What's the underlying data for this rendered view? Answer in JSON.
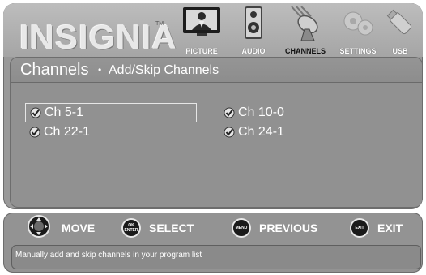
{
  "brand": {
    "logo": "INSIGNIA",
    "tm": "TM"
  },
  "tabs": [
    {
      "label": "PICTURE",
      "icon": "tv-picture-icon",
      "active": false
    },
    {
      "label": "AUDIO",
      "icon": "speaker-icon",
      "active": false
    },
    {
      "label": "CHANNELS",
      "icon": "satellite-dish-icon",
      "active": true
    },
    {
      "label": "SETTINGS",
      "icon": "gears-icon",
      "active": false
    },
    {
      "label": "USB",
      "icon": "usb-stick-icon",
      "active": false
    }
  ],
  "page": {
    "title": "Channels",
    "separator": "•",
    "subtitle": "Add/Skip Channels"
  },
  "channels": [
    {
      "label": "Ch 5-1",
      "checked": true,
      "selected": true
    },
    {
      "label": "Ch 10-0",
      "checked": true,
      "selected": false
    },
    {
      "label": "Ch 22-1",
      "checked": true,
      "selected": false
    },
    {
      "label": "Ch 24-1",
      "checked": true,
      "selected": false
    }
  ],
  "hints": [
    {
      "label": "MOVE",
      "icon": "dpad-icon"
    },
    {
      "label": "SELECT",
      "icon": "ok-enter-button-icon",
      "button_text": [
        "OK",
        "ENTER"
      ]
    },
    {
      "label": "PREVIOUS",
      "icon": "menu-button-icon",
      "button_text": [
        "MENU"
      ]
    },
    {
      "label": "EXIT",
      "icon": "exit-button-icon",
      "button_text": [
        "EXIT"
      ]
    }
  ],
  "status": {
    "text": "Manually add and skip channels in your program list"
  },
  "colors": {
    "panel": "#919191",
    "text": "#ffffff",
    "active_label": "#111111"
  }
}
